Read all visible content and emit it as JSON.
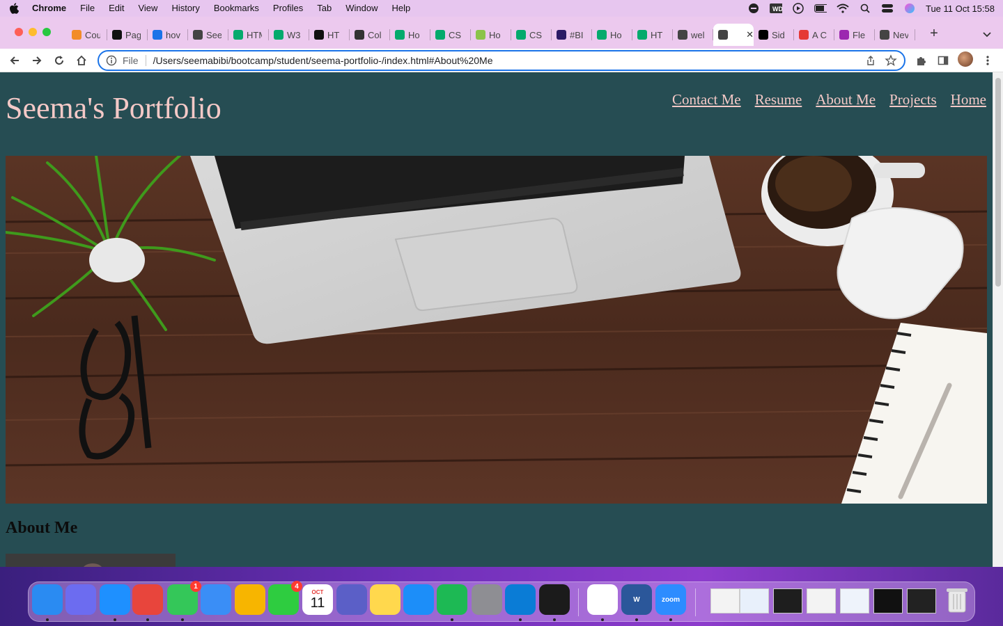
{
  "menubar": {
    "app_name": "Chrome",
    "items": [
      "File",
      "Edit",
      "View",
      "History",
      "Bookmarks",
      "Profiles",
      "Tab",
      "Window",
      "Help"
    ],
    "clock": "Tue 11 Oct  15:58"
  },
  "tabs": [
    {
      "title": "Cou",
      "icon": "c-icon",
      "color": "#f28c28"
    },
    {
      "title": "Pag",
      "icon": "github-icon",
      "color": "#111111"
    },
    {
      "title": "hov",
      "icon": "search-icon",
      "color": "#1a73e8"
    },
    {
      "title": "See",
      "icon": "globe-icon",
      "color": "#444444"
    },
    {
      "title": "HTM",
      "icon": "w3-icon",
      "color": "#04aa6d"
    },
    {
      "title": "W3",
      "icon": "w3-icon",
      "color": "#04aa6d"
    },
    {
      "title": "HT",
      "icon": "eh-icon",
      "color": "#111111"
    },
    {
      "title": "Col",
      "icon": "ch-icon",
      "color": "#333333"
    },
    {
      "title": "Ho",
      "icon": "w3-icon",
      "color": "#04aa6d"
    },
    {
      "title": "CS",
      "icon": "w3-icon",
      "color": "#04aa6d"
    },
    {
      "title": "Ho",
      "icon": "code-icon",
      "color": "#8bc34a"
    },
    {
      "title": "CS",
      "icon": "w3-icon",
      "color": "#04aa6d"
    },
    {
      "title": "#BI",
      "icon": "ac-icon",
      "color": "#2b1a66"
    },
    {
      "title": "Ho",
      "icon": "w3-icon",
      "color": "#04aa6d"
    },
    {
      "title": "HT",
      "icon": "w3-icon",
      "color": "#04aa6d"
    },
    {
      "title": "wel",
      "icon": "globe-icon",
      "color": "#444444"
    },
    {
      "title": "",
      "icon": "globe-icon",
      "color": "#444444",
      "active": true
    },
    {
      "title": "Sid",
      "icon": "dev-icon",
      "color": "#000000"
    },
    {
      "title": "A C",
      "icon": "asterisk-icon",
      "color": "#e53935"
    },
    {
      "title": "Fle",
      "icon": "ring-icon",
      "color": "#9c27b0"
    },
    {
      "title": "Nev",
      "icon": "globe-icon",
      "color": "#444444"
    }
  ],
  "address_bar": {
    "scheme": "File",
    "url": "/Users/seemabibi/bootcamp/student/seema-portfolio-/index.html#About%20Me"
  },
  "page": {
    "title": "Seema's Portfolio",
    "nav": [
      "Contact Me",
      "Resume",
      "About Me",
      "Projects",
      "Home"
    ],
    "about_heading": "About Me"
  },
  "dock": {
    "apps": [
      {
        "name": "finder-icon",
        "color": "#2a8bf2",
        "label": ""
      },
      {
        "name": "launchpad-icon",
        "color": "#6c6cf0",
        "label": ""
      },
      {
        "name": "safari-icon",
        "color": "#1e90ff",
        "label": ""
      },
      {
        "name": "chrome-icon",
        "color": "#e8453c",
        "label": ""
      },
      {
        "name": "messages-icon",
        "color": "#34c759",
        "label": "",
        "badge": "1"
      },
      {
        "name": "mail-icon",
        "color": "#3a8ef6",
        "label": ""
      },
      {
        "name": "photos-icon",
        "color": "#f7b500",
        "label": ""
      },
      {
        "name": "facetime-icon",
        "color": "#2ecc40",
        "label": "",
        "badge": "4"
      },
      {
        "name": "calendar-icon",
        "color": "#ffffff",
        "label": "11"
      },
      {
        "name": "teams-icon",
        "color": "#5b5fc7",
        "label": ""
      },
      {
        "name": "notes-icon",
        "color": "#ffd84d",
        "label": ""
      },
      {
        "name": "appstore-icon",
        "color": "#1c8ef9",
        "label": ""
      },
      {
        "name": "spotify-icon",
        "color": "#1db954",
        "label": ""
      },
      {
        "name": "settings-icon",
        "color": "#8e8e93",
        "label": ""
      },
      {
        "name": "vscode-icon",
        "color": "#0a7cd6",
        "label": ""
      },
      {
        "name": "terminal-icon",
        "color": "#1b1b1b",
        "label": ""
      },
      {
        "name": "slack-icon",
        "color": "#ffffff",
        "label": ""
      },
      {
        "name": "word-icon",
        "color": "#2b579a",
        "label": "W"
      },
      {
        "name": "zoom-icon",
        "color": "#2d8cff",
        "label": "zoom"
      }
    ],
    "calendar_month": "OCT"
  }
}
